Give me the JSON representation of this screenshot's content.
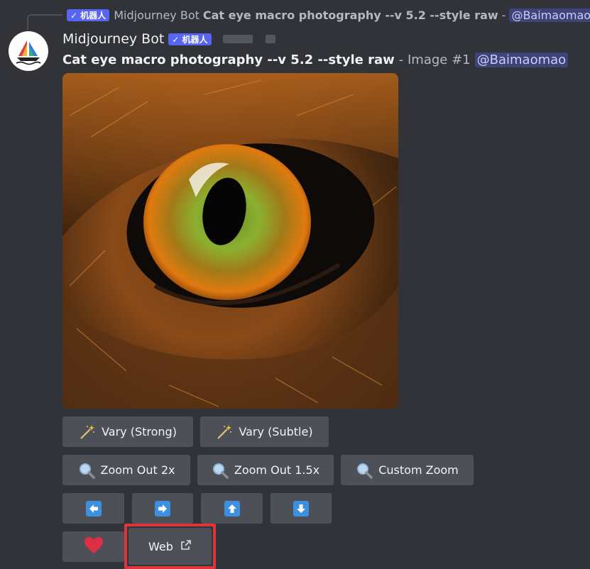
{
  "reply": {
    "badge": "✓ 机器人",
    "name": "Midjourney Bot",
    "prompt": "Cat eye macro photography --v 5.2 --style raw",
    "dash": "-",
    "mention": "@Baimaomao"
  },
  "header": {
    "username": "Midjourney Bot",
    "badge": "✓ 机器人"
  },
  "message": {
    "prompt": "Cat eye macro photography --v 5.2 --style raw",
    "rest": "- Image #1",
    "mention": "@Baimaomao"
  },
  "buttons": {
    "vary_strong": "Vary (Strong)",
    "vary_subtle": "Vary (Subtle)",
    "zoom_out_2x": "Zoom Out 2x",
    "zoom_out_1_5x": "Zoom Out 1.5x",
    "custom_zoom": "Custom Zoom",
    "web": "Web"
  },
  "colors": {
    "background": "#313338",
    "button": "#4e5058",
    "brand": "#5865f2",
    "arrow": "#3d8fe0",
    "heart": "#dd2e44",
    "highlight": "#e2333b"
  },
  "icons": {
    "vary": "magic-wand-icon",
    "zoom": "magnifier-icon",
    "pan_left": "arrow-left-icon",
    "pan_right": "arrow-right-icon",
    "pan_up": "arrow-up-icon",
    "pan_down": "arrow-down-icon",
    "favorite": "heart-icon",
    "external": "external-link-icon"
  }
}
